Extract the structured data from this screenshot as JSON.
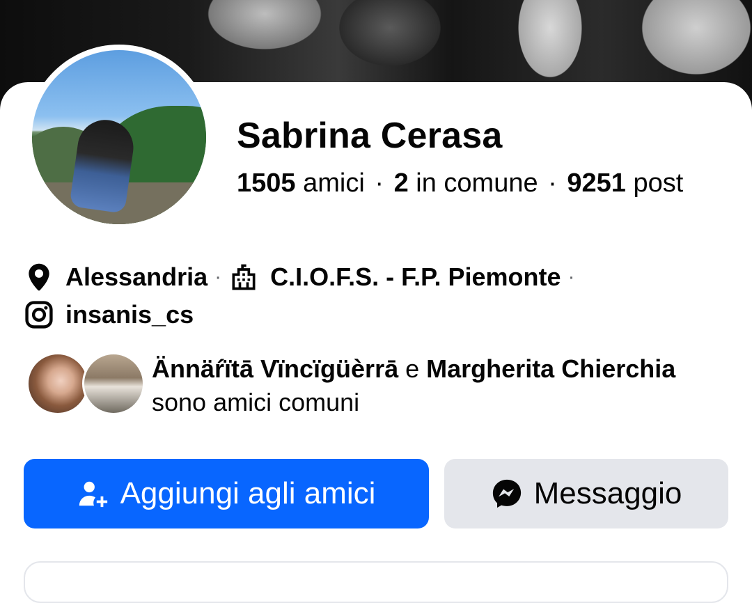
{
  "profile": {
    "name": "Sabrina Cerasa",
    "stats": {
      "friends_count": "1505",
      "friends_label": "amici",
      "mutual_count": "2",
      "mutual_label": "in comune",
      "posts_count": "9251",
      "posts_label": "post",
      "separator": "·"
    }
  },
  "info": {
    "location": "Alessandria",
    "school": "C.I.O.F.S. - F.P. Piemonte",
    "instagram": "insanis_cs",
    "separator": "·"
  },
  "mutual_friends": {
    "friend1": "Ännäŕïtā Vïncïgüèrrā",
    "conjunction": "e",
    "friend2": "Margherita Chierchia",
    "suffix": "sono amici comuni"
  },
  "actions": {
    "add_friend_label": "Aggiungi agli amici",
    "message_label": "Messaggio"
  },
  "colors": {
    "primary_button": "#0866ff",
    "secondary_button": "#e4e6eb",
    "text": "#050505"
  },
  "icons": {
    "location": "location-pin-icon",
    "school": "school-building-icon",
    "instagram": "instagram-icon",
    "add_friend": "add-friend-icon",
    "messenger": "messenger-icon"
  }
}
